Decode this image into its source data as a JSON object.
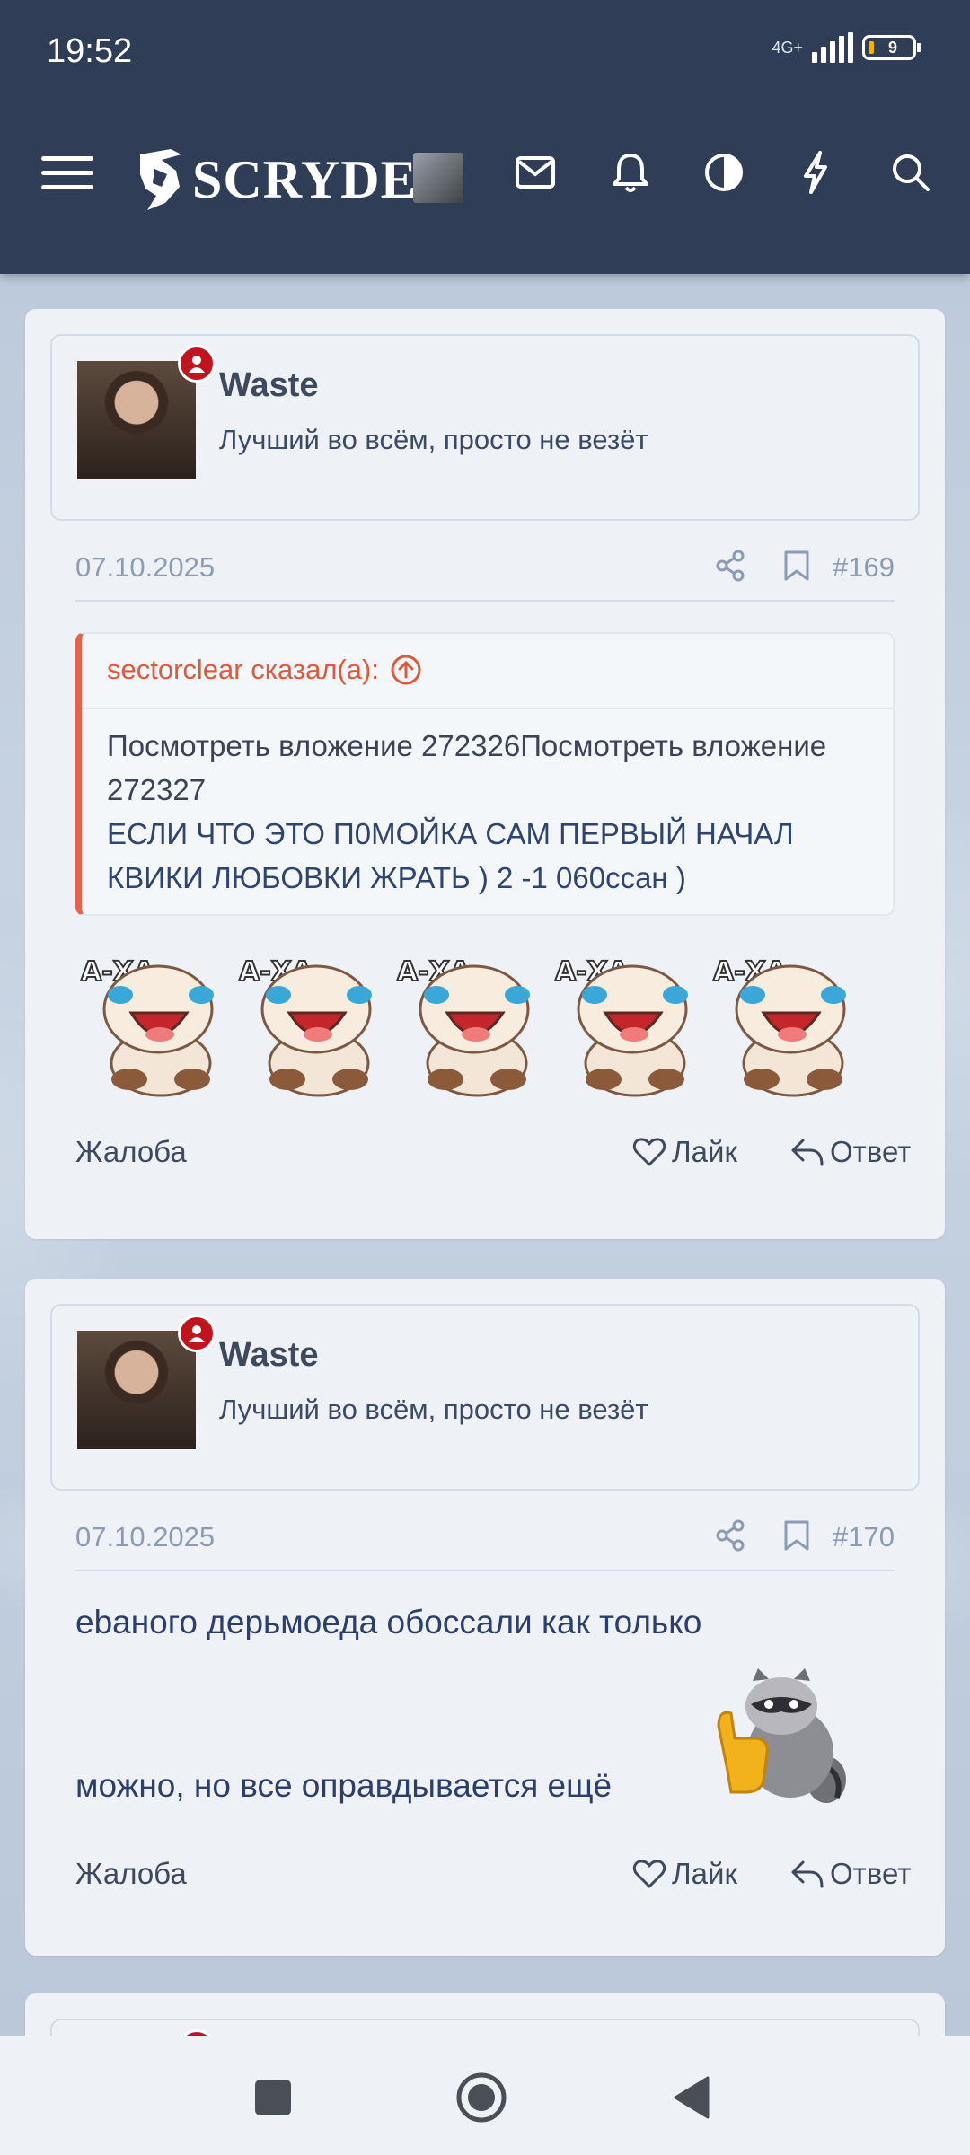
{
  "status_bar": {
    "time": "19:52",
    "network": "4G+",
    "battery": "9"
  },
  "header": {
    "logo_text": "SCRYDE",
    "icons": [
      "menu-icon",
      "mail-icon",
      "bell-icon",
      "contrast-icon",
      "bolt-icon",
      "search-icon"
    ]
  },
  "posts": [
    {
      "username": "Waste",
      "user_title": "Лучший во всём, просто не везёт",
      "date": "07.10.2025",
      "number": "#169",
      "quote": {
        "author": "sectorclear сказал(а):",
        "line1": "Посмотреть вложение 272326Посмотреть вложение 272327",
        "line2": "ЕСЛИ ЧТО ЭТО П0МОЙКА САМ ПЕРВЫЙ НАЧАЛ КВИКИ ЛЮБОВКИ ЖРАТЬ ) 2 -1 060ссан )"
      },
      "sticker_text": "А-ХА",
      "report": "Жалоба",
      "like": "Лайк",
      "reply": "Ответ"
    },
    {
      "username": "Waste",
      "user_title": "Лучший во всём, просто не везёт",
      "date": "07.10.2025",
      "number": "#170",
      "text_line1": "ebаного дерьмоеда обоссали как только",
      "text_line2": "можно, но все оправдывается ещё",
      "report": "Жалоба",
      "like": "Лайк",
      "reply": "Ответ"
    }
  ],
  "colors": {
    "header_bg": "#2f3e56",
    "card_bg": "#eef2f7",
    "quote_accent": "#e2583d",
    "badge": "#c0141f"
  }
}
